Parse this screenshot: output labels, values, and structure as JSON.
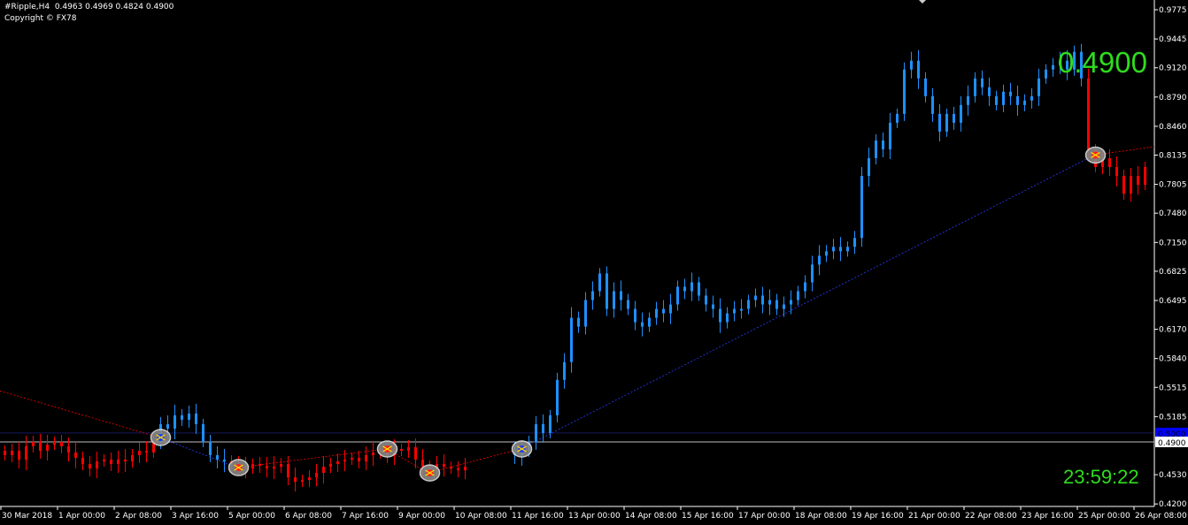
{
  "header": {
    "symbol_line": "#Ripple,H4  0.4963 0.4969 0.4824 0.4900",
    "copyright": "Copyright © FX78"
  },
  "overlay": {
    "price_big": "0.4900",
    "countdown": "23:59:22"
  },
  "colors": {
    "background": "#000000",
    "bull": "#1e90ff",
    "bear": "#ff0000",
    "text_green": "#2fdc1e",
    "axis": "#ffffff",
    "current_price_line": "#c0c0c0",
    "blue_marker": "#0000ff"
  },
  "chart_data": {
    "type": "bar",
    "symbol": "#Ripple",
    "timeframe": "H4",
    "ylim": [
      0.42,
      0.9775
    ],
    "y_ticks": [
      "0.9775",
      "0.9445",
      "0.9120",
      "0.8790",
      "0.8460",
      "0.8135",
      "0.7805",
      "0.7480",
      "0.7150",
      "0.6825",
      "0.6495",
      "0.6170",
      "0.5840",
      "0.5515",
      "0.5185",
      "0.4530",
      "0.4200"
    ],
    "x_ticks": [
      "30 Mar 2018",
      "1 Apr 00:00",
      "2 Apr 08:00",
      "3 Apr 16:00",
      "5 Apr 00:00",
      "6 Apr 08:00",
      "7 Apr 16:00",
      "9 Apr 00:00",
      "10 Apr 08:00",
      "11 Apr 16:00",
      "13 Apr 00:00",
      "14 Apr 08:00",
      "15 Apr 16:00",
      "17 Apr 00:00",
      "18 Apr 08:00",
      "19 Apr 16:00",
      "21 Apr 00:00",
      "22 Apr 08:00",
      "23 Apr 16:00",
      "25 Apr 00:00",
      "26 Apr 08:00"
    ],
    "current_price": "0.4900",
    "marker_price": "0.5000",
    "closes": [
      0.475,
      0.48,
      0.47,
      0.485,
      0.49,
      0.48,
      0.487,
      0.49,
      0.485,
      0.478,
      0.472,
      0.465,
      0.46,
      0.468,
      0.47,
      0.465,
      0.47,
      0.468,
      0.475,
      0.48,
      0.478,
      0.49,
      0.51,
      0.505,
      0.52,
      0.515,
      0.522,
      0.51,
      0.49,
      0.475,
      0.47,
      0.468,
      0.465,
      0.462,
      0.46,
      0.465,
      0.463,
      0.46,
      0.462,
      0.465,
      0.45,
      0.445,
      0.447,
      0.45,
      0.455,
      0.462,
      0.465,
      0.468,
      0.47,
      0.472,
      0.468,
      0.475,
      0.478,
      0.48,
      0.475,
      0.482,
      0.48,
      0.484,
      0.47,
      0.462,
      0.46,
      0.465,
      0.462,
      0.46,
      0.458,
      0.462,
      null,
      null,
      null,
      null,
      null,
      null,
      0.475,
      0.48,
      0.49,
      0.51,
      0.5,
      0.52,
      0.56,
      0.58,
      0.63,
      0.62,
      0.65,
      0.66,
      0.68,
      0.64,
      0.66,
      0.65,
      0.64,
      0.625,
      0.62,
      0.63,
      0.64,
      0.635,
      0.645,
      0.665,
      0.66,
      0.67,
      0.655,
      0.645,
      0.64,
      0.625,
      0.635,
      0.64,
      0.64,
      0.65,
      0.655,
      0.645,
      0.65,
      0.64,
      0.645,
      0.65,
      0.66,
      0.67,
      0.69,
      0.7,
      0.705,
      0.71,
      0.705,
      0.71,
      0.72,
      0.79,
      0.81,
      0.83,
      0.82,
      0.85,
      0.86,
      0.91,
      0.92,
      0.9,
      0.88,
      0.86,
      0.84,
      0.86,
      0.85,
      0.87,
      0.88,
      0.9,
      0.89,
      0.88,
      0.87,
      0.885,
      0.88,
      0.87,
      0.875,
      0.88,
      0.9,
      0.91,
      0.915,
      0.92,
      0.91,
      0.93,
      0.9,
      0.82,
      0.8,
      0.81,
      0.8,
      0.79,
      0.77,
      0.79,
      0.78,
      0.8
    ],
    "trend_segments": [
      {
        "from": 0,
        "to": 21,
        "trend": "bear"
      },
      {
        "from": 22,
        "to": 31,
        "trend": "bull"
      },
      {
        "from": 32,
        "to": 71,
        "trend": "bear"
      },
      {
        "from": 72,
        "to": 152,
        "trend": "bull"
      },
      {
        "from": 153,
        "to": 161,
        "trend": "bear"
      }
    ],
    "signals": [
      {
        "bar": 22,
        "price": 0.495
      },
      {
        "bar": 33,
        "price": 0.461
      },
      {
        "bar": 54,
        "price": 0.482
      },
      {
        "bar": 60,
        "price": 0.455
      },
      {
        "bar": 73,
        "price": 0.482
      },
      {
        "bar": 154,
        "price": 0.8135
      }
    ]
  }
}
